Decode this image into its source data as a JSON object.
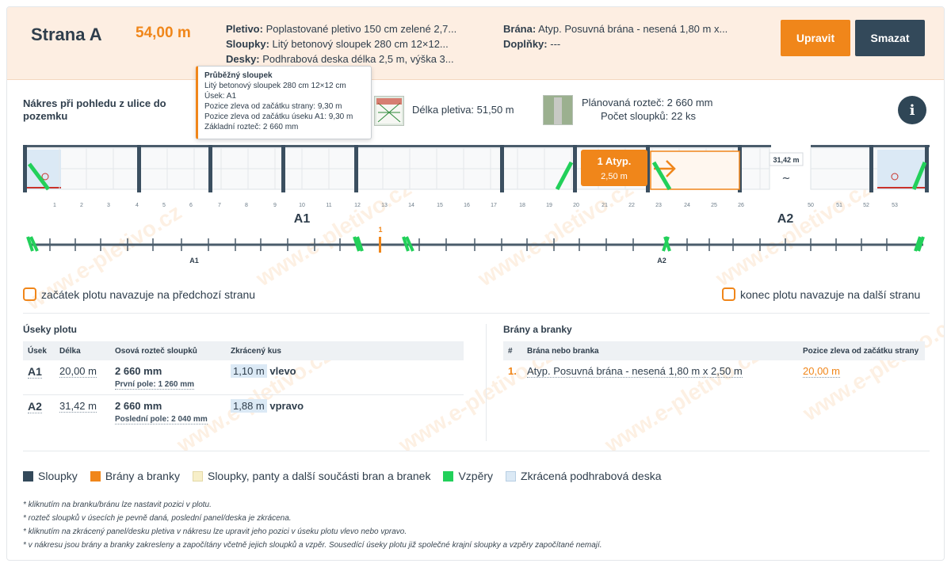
{
  "header": {
    "title": "Strana A",
    "length": "54,00 m",
    "specs": {
      "pletivo_label": "Pletivo:",
      "pletivo_value": "Poplastované pletivo 150 cm zelené 2,7...",
      "sloupky_label": "Sloupky:",
      "sloupky_value": "Litý betonový sloupek 280 cm 12×12...",
      "desky_label": "Desky:",
      "desky_value": "Podhrabová deska délka 2,5 m, výška 3...",
      "brana_label": "Brána:",
      "brana_value": "Atyp. Posuvná brána - nesená 1,80 m x...",
      "doplnky_label": "Doplňky:",
      "doplnky_value": "---"
    },
    "edit_label": "Upravit",
    "delete_label": "Smazat"
  },
  "tooltip": {
    "lines": [
      "Průběžný sloupek",
      "Litý betonový sloupek 280 cm 12×12 cm",
      "Úsek: A1",
      "Pozice zleva od začátku strany: 9,30 m",
      "Pozice zleva od začátku úseku A1: 9,30 m",
      "Základní rozteč: 2 660 mm"
    ]
  },
  "drawing": {
    "title": "Nákres při pohledu z ulice do pozemku",
    "mesh_length": "Délka pletiva: 51,50 m",
    "planned_spacing": "Plánovaná rozteč: 2 660 mm",
    "post_count": "Počet sloupků: 22 ks",
    "info_icon": "info-icon"
  },
  "fence": {
    "post_labels": [
      "1",
      "2",
      "3",
      "4",
      "5",
      "6",
      "7",
      "8",
      "9",
      "10",
      "11",
      "12",
      "13",
      "14",
      "15",
      "16",
      "17",
      "18",
      "19",
      "20",
      "21",
      "22",
      "23",
      "24",
      "25",
      "26",
      "50",
      "51",
      "52",
      "53"
    ],
    "section_a1": "A1",
    "section_a2": "A2",
    "gate_title": "1 Atyp.",
    "gate_width": "2,50 m",
    "gap_label": "31,42 m",
    "gap_symbol": "~",
    "overview_marker": "1",
    "overview_a1": "A1",
    "overview_a2": "A2"
  },
  "options": {
    "start_connects": "začátek plotu navazuje na předchozí stranu",
    "end_connects": "konec plotu navazuje na další stranu"
  },
  "sections": {
    "title": "Úseky plotu",
    "columns": [
      "Úsek",
      "Délka",
      "Osová rozteč sloupků",
      "Zkrácený kus"
    ],
    "rows": [
      {
        "id": "A1",
        "length": "20,00 m",
        "spacing": "2 660 mm",
        "spacing_note": "První pole: 1 260 mm",
        "cut": "1,10 m",
        "cut_side": "vlevo"
      },
      {
        "id": "A2",
        "length": "31,42 m",
        "spacing": "2 660 mm",
        "spacing_note": "Poslední pole: 2 040 mm",
        "cut": "1,88 m",
        "cut_side": "vpravo"
      }
    ]
  },
  "gates": {
    "title": "Brány a branky",
    "columns": [
      "#",
      "Brána nebo branka",
      "Pozice zleva od začátku strany"
    ],
    "rows": [
      {
        "num": "1.",
        "name": "Atyp. Posuvná brána - nesená 1,80 m x 2,50 m",
        "position": "20,00 m"
      }
    ]
  },
  "legend": [
    {
      "label": "Sloupky",
      "color": "#33495a"
    },
    {
      "label": "Brány a branky",
      "color": "#f0861a"
    },
    {
      "label": "Sloupky, panty a další součásti bran a branek",
      "color": "#f7efc9"
    },
    {
      "label": "Vzpěry",
      "color": "#22d05a"
    },
    {
      "label": "Zkrácená podhrabová deska",
      "color": "#dbe9f5"
    }
  ],
  "notes": [
    "* kliknutím na branku/bránu lze nastavit pozici v plotu.",
    "* rozteč sloupků v úsecích je pevně daná, poslední panel/deska je zkrácena.",
    "* kliknutím na zkrácený panel/desku pletiva v nákresu lze upravit jeho pozici v úseku plotu vlevo nebo vpravo.",
    "* v nákresu jsou brány a branky zakresleny a započítány včetně jejich sloupků a vzpěr. Sousedící úseky plotu již společné krajní sloupky a vzpěry započítané nemají."
  ],
  "watermark": "www.e-pletivo.cz"
}
